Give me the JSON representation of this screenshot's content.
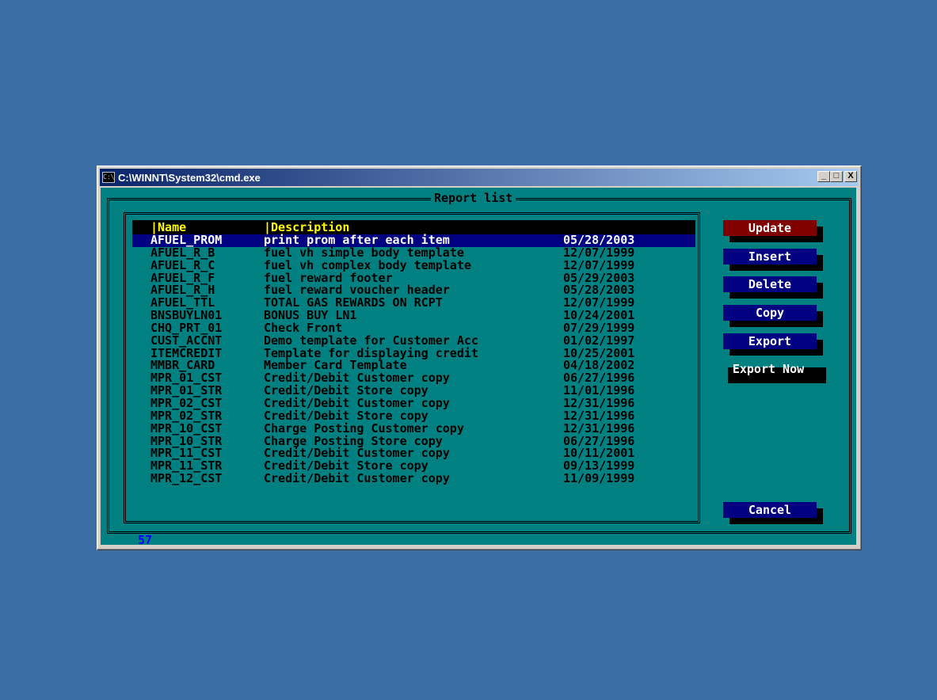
{
  "window": {
    "title": "C:\\WINNT\\System32\\cmd.exe",
    "icon_label": "C:\\",
    "buttons": {
      "minimize": "_",
      "maximize": "□",
      "close": "X"
    }
  },
  "dialog": {
    "title": "Report list",
    "columns": {
      "name": "|Name",
      "description": "|Description"
    },
    "rows": [
      {
        "name": "AFUEL_PROM",
        "description": "print prom after each item",
        "date": "05/28/2003",
        "selected": true
      },
      {
        "name": "AFUEL_R_B",
        "description": "fuel vh simple body template",
        "date": "12/07/1999"
      },
      {
        "name": "AFUEL_R_C",
        "description": "fuel vh complex body template",
        "date": "12/07/1999"
      },
      {
        "name": "AFUEL_R_F",
        "description": "fuel reward footer",
        "date": "05/29/2003"
      },
      {
        "name": "AFUEL_R_H",
        "description": "fuel reward voucher header",
        "date": "05/28/2003"
      },
      {
        "name": "AFUEL_TTL",
        "description": "TOTAL GAS REWARDS ON RCPT",
        "date": "12/07/1999"
      },
      {
        "name": "BNSBUYLN01",
        "description": "BONUS BUY LN1",
        "date": "10/24/2001"
      },
      {
        "name": "CHQ_PRT_01",
        "description": "Check Front",
        "date": "07/29/1999"
      },
      {
        "name": "CUST_ACCNT",
        "description": "Demo template for Customer Acc",
        "date": "01/02/1997"
      },
      {
        "name": "ITEMCREDIT",
        "description": "Template for displaying credit",
        "date": "10/25/2001"
      },
      {
        "name": "MMBR_CARD",
        "description": "Member Card Template",
        "date": "04/18/2002"
      },
      {
        "name": "MPR_01_CST",
        "description": "Credit/Debit Customer copy",
        "date": "06/27/1996"
      },
      {
        "name": "MPR_01_STR",
        "description": "Credit/Debit Store copy",
        "date": "11/01/1996"
      },
      {
        "name": "MPR_02_CST",
        "description": "Credit/Debit Customer copy",
        "date": "12/31/1996"
      },
      {
        "name": "MPR_02_STR",
        "description": "Credit/Debit Store copy",
        "date": "12/31/1996"
      },
      {
        "name": "MPR_10_CST",
        "description": "Charge Posting Customer copy",
        "date": "12/31/1996"
      },
      {
        "name": "MPR_10_STR",
        "description": "Charge Posting Store copy",
        "date": "06/27/1996"
      },
      {
        "name": "MPR_11_CST",
        "description": "Credit/Debit Customer copy",
        "date": "10/11/2001"
      },
      {
        "name": "MPR_11_STR",
        "description": "Credit/Debit Store copy",
        "date": "09/13/1999"
      },
      {
        "name": "MPR_12_CST",
        "description": "Credit/Debit Customer copy",
        "date": "11/09/1999"
      }
    ],
    "buttons": {
      "update": "Update",
      "insert": "Insert",
      "delete": "Delete",
      "copy": "Copy",
      "export": "Export",
      "export_now": "Export Now",
      "cancel": "Cancel"
    },
    "record_count": "57"
  },
  "colors": {
    "desktop": "#3a6ea5",
    "console_bg": "#008080",
    "selected_row": "#000080",
    "header_text": "#ffff00",
    "update_button": "#800000",
    "button": "#000080",
    "count_text": "#0000ff"
  }
}
